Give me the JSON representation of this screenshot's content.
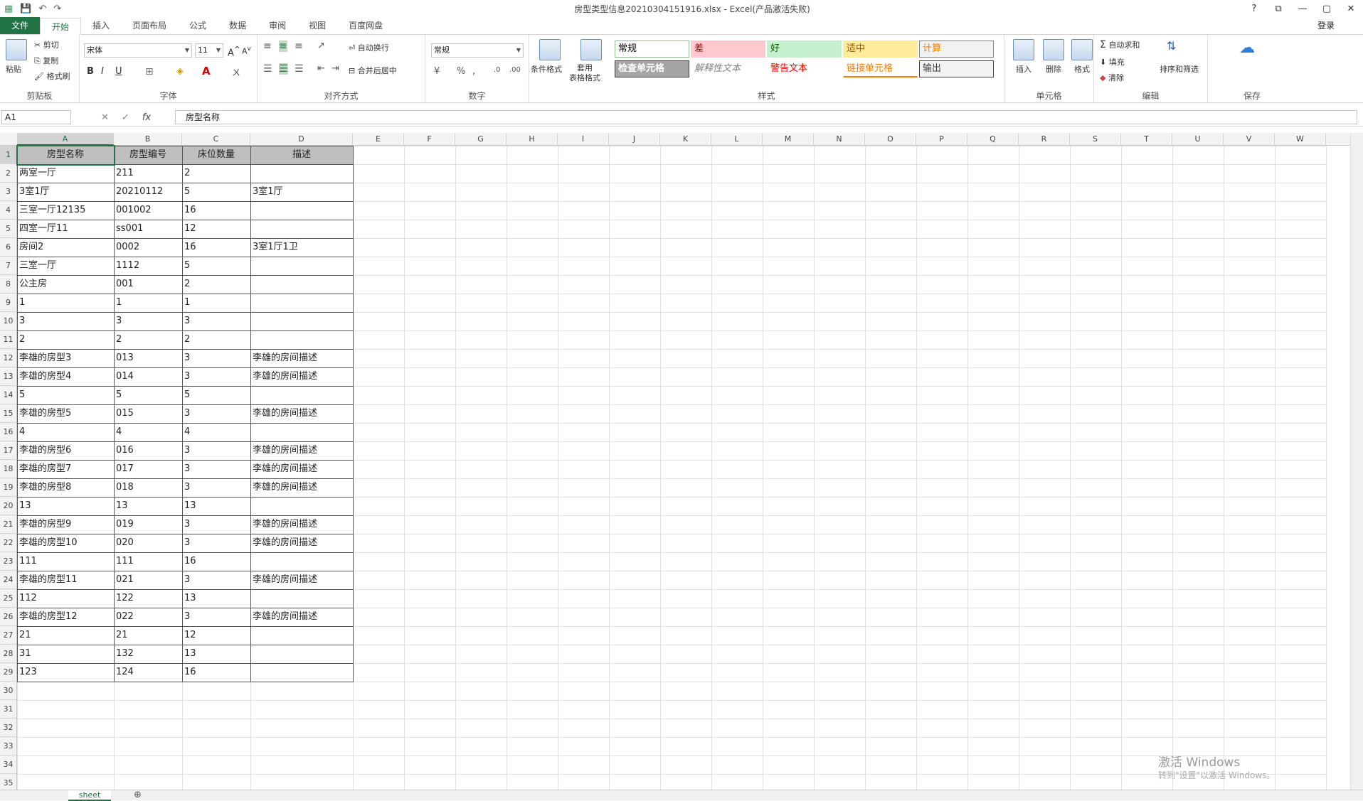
{
  "window": {
    "title": "房型类型信息20210304151916.xlsx - Excel(产品激活失败)",
    "help": "?",
    "min": "—",
    "restore": "▢",
    "close": "✕"
  },
  "tabs": [
    {
      "label": "文件"
    },
    {
      "label": "开始"
    },
    {
      "label": "插入"
    },
    {
      "label": "页面布局"
    },
    {
      "label": "公式"
    },
    {
      "label": "数据"
    },
    {
      "label": "审阅"
    },
    {
      "label": "视图"
    },
    {
      "label": "百度网盘"
    }
  ],
  "login": "登录",
  "ribbon": {
    "clipboard": {
      "label": "剪贴板",
      "paste": "粘贴",
      "cut": "剪切",
      "copy": "复制",
      "format_painter": "格式刷"
    },
    "font": {
      "label": "字体",
      "name": "宋体",
      "size": "11"
    },
    "align": {
      "label": "对齐方式",
      "wrap": "自动换行",
      "merge": "合并后居中"
    },
    "number": {
      "label": "数字",
      "format": "常规"
    },
    "styles": {
      "label": "样式",
      "cond_format": "条件格式",
      "table_format": "套用\n表格格式",
      "cells": [
        {
          "text": "常规",
          "bg": "#ffffff",
          "color": "#000000",
          "border": "#8fbc8f"
        },
        {
          "text": "差",
          "bg": "#ffc7ce",
          "color": "#9c0006",
          "border": "#ffc7ce"
        },
        {
          "text": "好",
          "bg": "#c6efce",
          "color": "#006100",
          "border": "#c6efce"
        },
        {
          "text": "适中",
          "bg": "#ffeb9c",
          "color": "#9c5700",
          "border": "#ffeb9c"
        },
        {
          "text": "计算",
          "bg": "#f2f2f2",
          "color": "#fa7d00",
          "border": "#7f7f7f"
        },
        {
          "text": "检查单元格",
          "bg": "#a5a5a5",
          "color": "#ffffff",
          "border": "#3f3f3f"
        },
        {
          "text": "解释性文本",
          "bg": "#ffffff",
          "color": "#7f7f7f",
          "border": "#ffffff"
        },
        {
          "text": "警告文本",
          "bg": "#ffffff",
          "color": "#ff0000",
          "border": "#ffffff"
        },
        {
          "text": "链接单元格",
          "bg": "#ffffff",
          "color": "#fa7d00",
          "border": "#ffffff"
        },
        {
          "text": "输出",
          "bg": "#f2f2f2",
          "color": "#3f3f3f",
          "border": "#3f3f3f"
        }
      ]
    },
    "cells_group": {
      "label": "单元格",
      "insert": "插入",
      "delete": "删除",
      "format": "格式"
    },
    "edit": {
      "label": "编辑",
      "autosum": "自动求和",
      "fill": "填充",
      "clear": "清除",
      "sort": "排序和筛选"
    },
    "save": {
      "label": "保存"
    }
  },
  "formula_bar": {
    "name_box": "A1",
    "content": "房型名称"
  },
  "columns": [
    "A",
    "B",
    "C",
    "D",
    "E",
    "F",
    "G",
    "H",
    "I",
    "J",
    "K",
    "L",
    "M",
    "N",
    "O",
    "P",
    "Q",
    "R",
    "S",
    "T",
    "U",
    "V",
    "W"
  ],
  "table": {
    "headers": [
      "房型名称",
      "房型编号",
      "床位数量",
      "描述"
    ],
    "rows": [
      [
        "两室一厅",
        "211",
        "2",
        ""
      ],
      [
        "3室1厅",
        "20210112",
        "5",
        "3室1厅"
      ],
      [
        "三室一厅12135",
        "001002",
        "16",
        ""
      ],
      [
        "四室一厅11",
        "ss001",
        "12",
        ""
      ],
      [
        "房间2",
        "0002",
        "16",
        "3室1厅1卫"
      ],
      [
        "三室一厅",
        "1112",
        "5",
        ""
      ],
      [
        "公主房",
        "001",
        "2",
        ""
      ],
      [
        "1",
        "1",
        "1",
        ""
      ],
      [
        "3",
        "3",
        "3",
        ""
      ],
      [
        "2",
        "2",
        "2",
        ""
      ],
      [
        "李雄的房型3",
        "013",
        "3",
        "李雄的房间描述"
      ],
      [
        "李雄的房型4",
        "014",
        "3",
        "李雄的房间描述"
      ],
      [
        "5",
        "5",
        "5",
        ""
      ],
      [
        "李雄的房型5",
        "015",
        "3",
        "李雄的房间描述"
      ],
      [
        "4",
        "4",
        "4",
        ""
      ],
      [
        "李雄的房型6",
        "016",
        "3",
        "李雄的房间描述"
      ],
      [
        "李雄的房型7",
        "017",
        "3",
        "李雄的房间描述"
      ],
      [
        "李雄的房型8",
        "018",
        "3",
        "李雄的房间描述"
      ],
      [
        "13",
        "13",
        "13",
        ""
      ],
      [
        "李雄的房型9",
        "019",
        "3",
        "李雄的房间描述"
      ],
      [
        "李雄的房型10",
        "020",
        "3",
        "李雄的房间描述"
      ],
      [
        "111",
        "111",
        "16",
        ""
      ],
      [
        "李雄的房型11",
        "021",
        "3",
        "李雄的房间描述"
      ],
      [
        "112",
        "122",
        "13",
        ""
      ],
      [
        "李雄的房型12",
        "022",
        "3",
        "李雄的房间描述"
      ],
      [
        "21",
        "21",
        "12",
        ""
      ],
      [
        "31",
        "132",
        "13",
        ""
      ],
      [
        "123",
        "124",
        "16",
        ""
      ]
    ]
  },
  "row_numbers": [
    "1",
    "2",
    "3",
    "4",
    "5",
    "6",
    "7",
    "8",
    "9",
    "10",
    "11",
    "12",
    "13",
    "14",
    "15",
    "16",
    "17",
    "18",
    "19",
    "20",
    "21",
    "22",
    "23",
    "24",
    "25",
    "26",
    "27",
    "28",
    "29",
    "30",
    "31",
    "32",
    "33",
    "34",
    "35"
  ],
  "sheet_tab": "sheet",
  "watermark": {
    "line1": "激活 Windows",
    "line2": "转到\"设置\"以激活 Windows。"
  }
}
